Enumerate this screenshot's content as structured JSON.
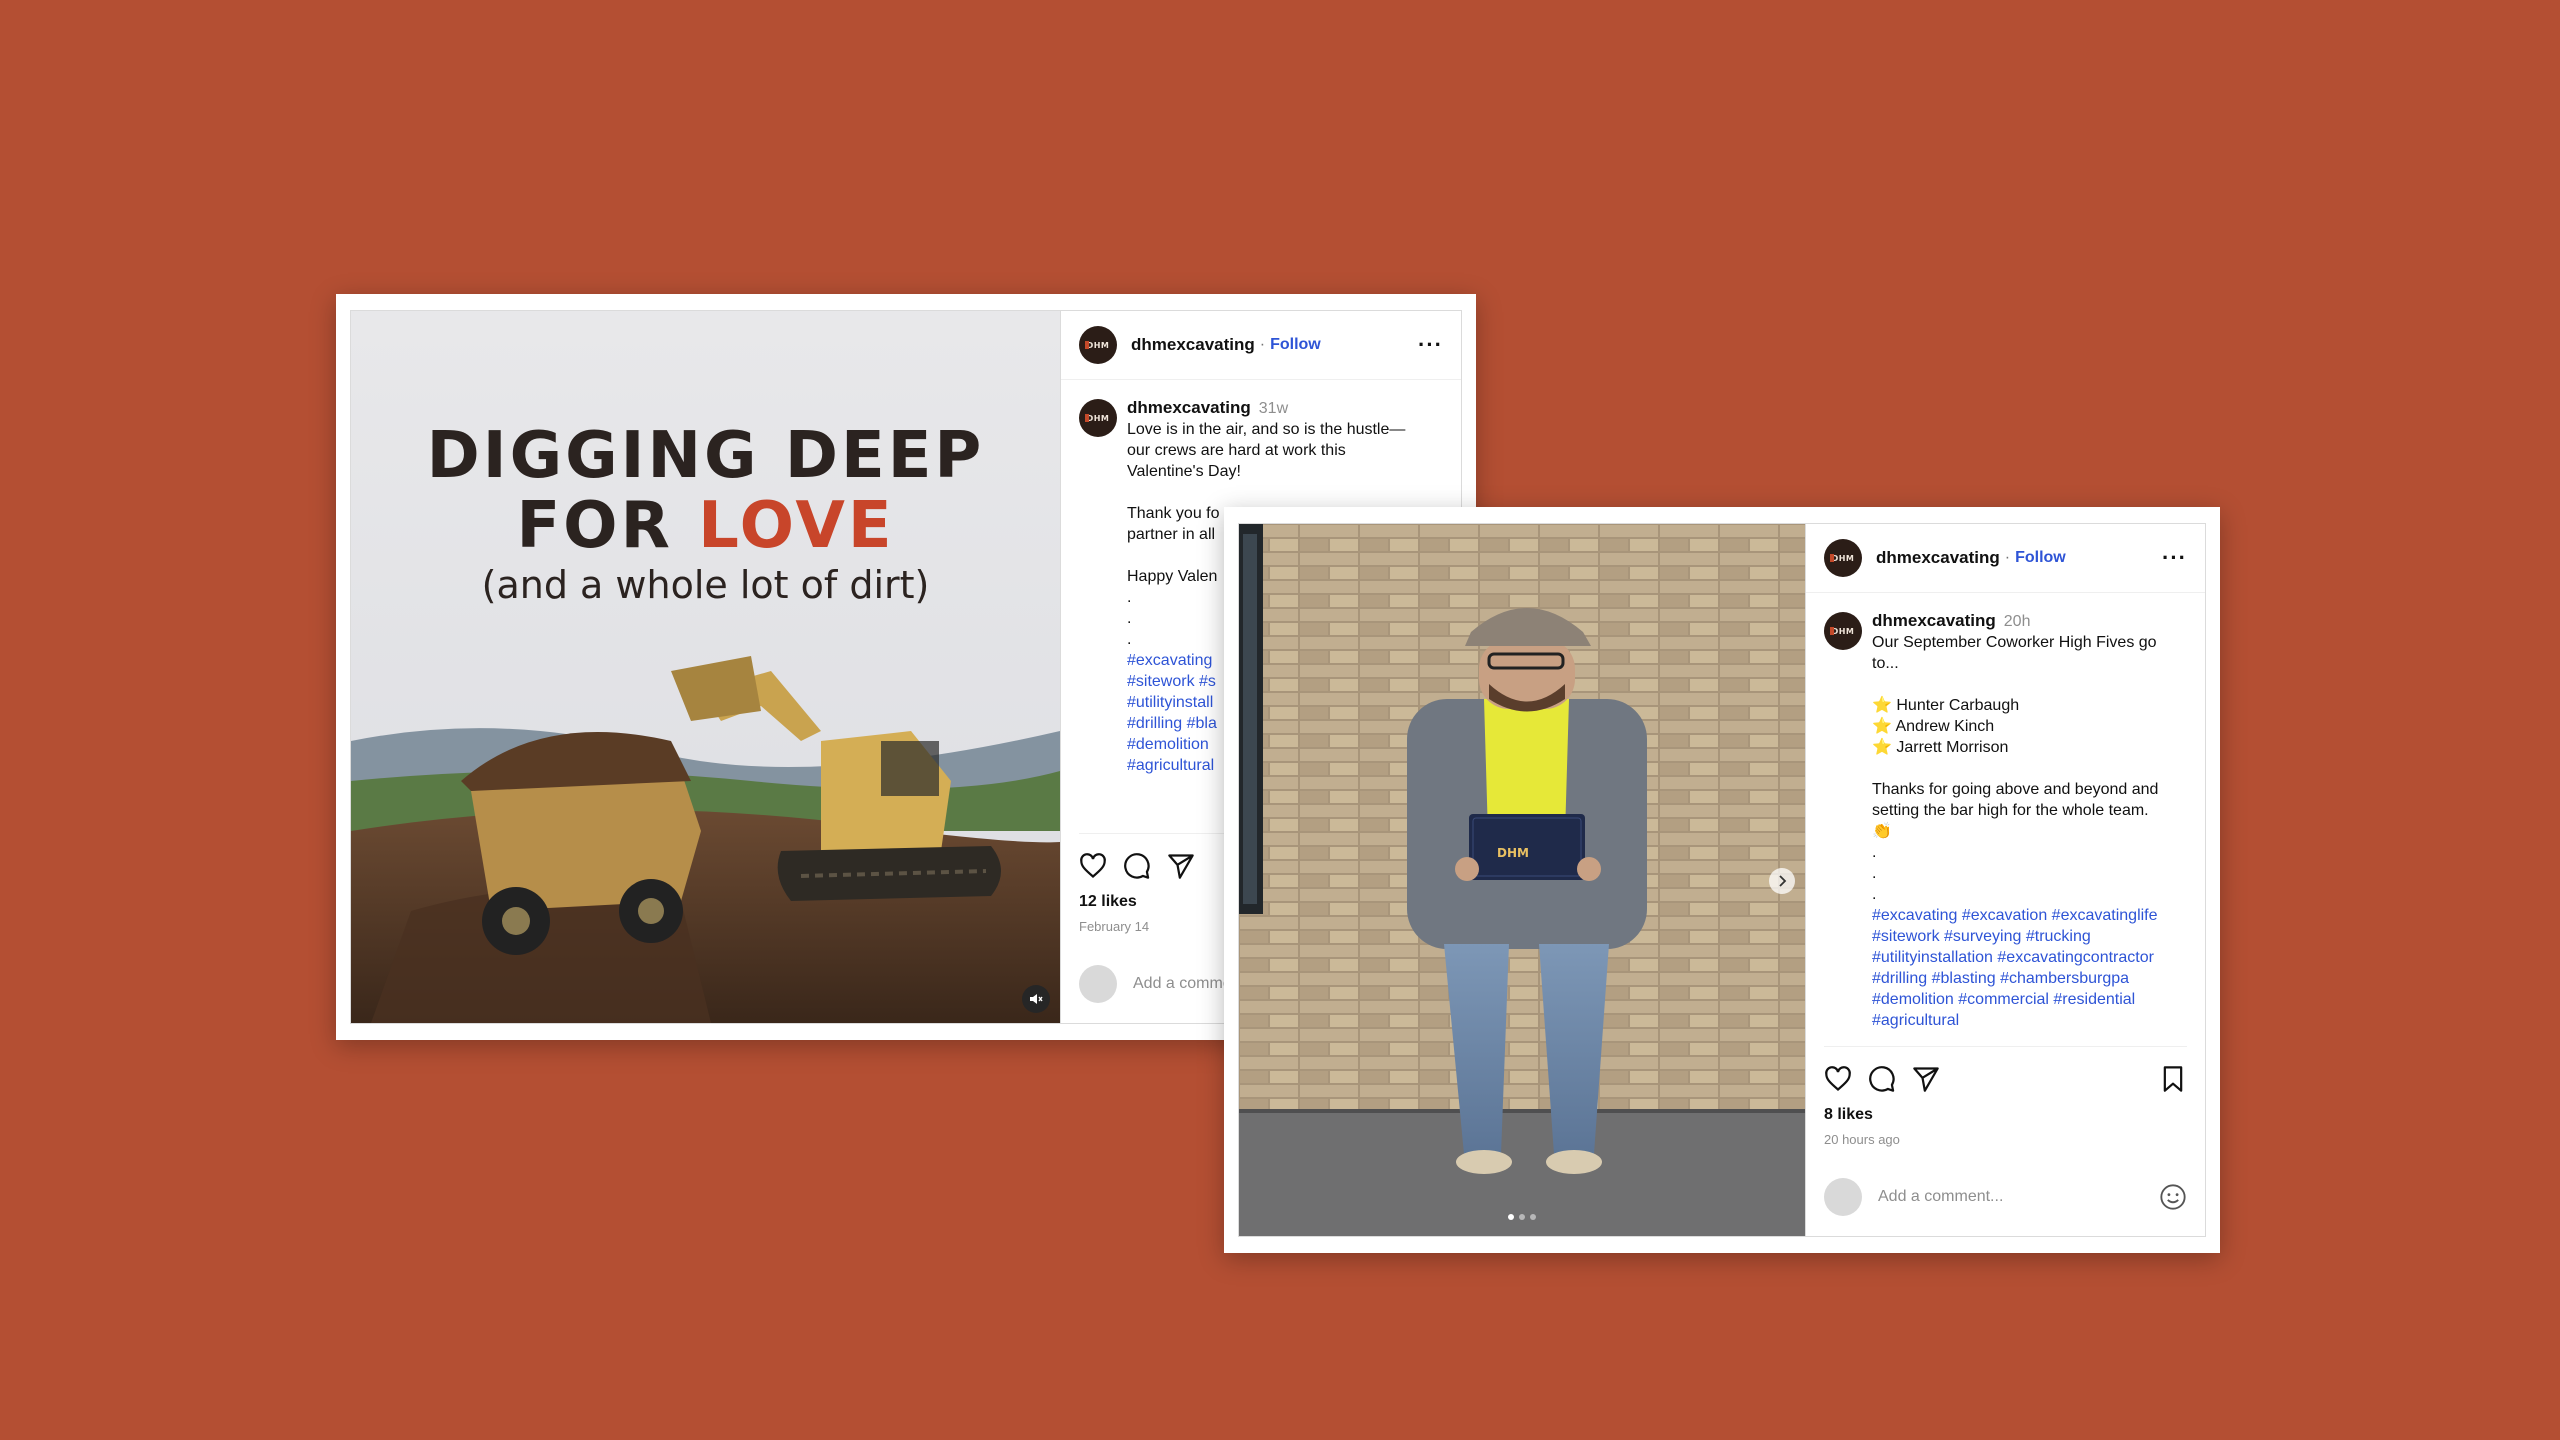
{
  "post1": {
    "username": "dhmexcavating",
    "follow_label": "Follow",
    "more_label": "···",
    "avatar_text": "DHM",
    "image": {
      "line1": "DIGGING DEEP",
      "line2a": "FOR ",
      "line2b": "LOVE",
      "line3": "(and a whole lot of dirt)"
    },
    "caption_user": "dhmexcavating",
    "caption_time": "31w",
    "caption_text": "Love is in the air, and so is the hustle—\nour crews are hard at work this\nValentine's Day!\n\nThank you fo\npartner in all\n\nHappy Valen\n.\n.\n.",
    "caption_tags": "#excavating\n#sitework #s\n#utilityinstall\n#drilling #bla\n#demolition\n#agricultural",
    "likes": "12 likes",
    "date": "February 14",
    "comment_placeholder": "Add a comment..."
  },
  "post2": {
    "username": "dhmexcavating",
    "follow_label": "Follow",
    "more_label": "···",
    "avatar_text": "DHM",
    "certificate_text": "DHM",
    "caption_user": "dhmexcavating",
    "caption_time": "20h",
    "caption_text": "Our September Coworker High Fives go\nto...\n\n⭐ Hunter Carbaugh\n⭐ Andrew Kinch\n⭐ Jarrett Morrison\n\nThanks for going above and beyond and\nsetting the bar high for the whole team.\n👏\n.\n.\n.",
    "caption_tags": "#excavating #excavation #excavatinglife\n#sitework #surveying #trucking\n#utilityinstallation #excavatingcontractor\n#drilling #blasting #chambersburgpa\n#demolition #commercial #residential\n#agricultural",
    "likes": "8 likes",
    "date": "20 hours ago",
    "comment_placeholder": "Add a comment...",
    "carousel_dots": 3
  },
  "colors": {
    "background": "#b44f33",
    "link": "#2e54d6",
    "love_accent": "#c8452a"
  }
}
